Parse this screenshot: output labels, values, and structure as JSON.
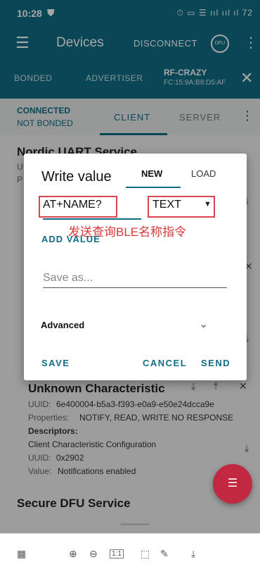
{
  "status": {
    "time": "10:28",
    "left_icon": "shield-icon",
    "right": "⏱ ▭ ☰ ııl ııl ıl 72"
  },
  "appbar": {
    "title": "Devices",
    "disconnect": "DISCONNECT",
    "dfu": "DFU"
  },
  "tabs": {
    "bonded": "BONDED",
    "advertiser": "ADVERTISER",
    "device_name": "RF-CRAZY",
    "device_mac": "FC:15:9A:B8:D5:AF"
  },
  "subtabs": {
    "connected": "CONNECTED",
    "not_bonded": "NOT BONDED",
    "client": "CLIENT",
    "server": "SERVER"
  },
  "background": {
    "service1": "Nordic UART Service",
    "frag_u": "U",
    "frag_p": "P",
    "characteristic": "Unknown Characteristic",
    "uuid_label": "UUID:",
    "uuid": "6e400004-b5a3-f393-e0a9-e50e24dcca9e",
    "props_label": "Properties:",
    "props": "NOTIFY, READ, WRITE NO RESPONSE",
    "descriptors": "Descriptors:",
    "desc_name": "Client Characteristic Configuration",
    "desc_uuid_label": "UUID:",
    "desc_uuid": "0x2902",
    "value_label": "Value:",
    "value": "Notifications enabled",
    "service2": "Secure DFU Service"
  },
  "dialog": {
    "title": "Write value",
    "tab_new": "NEW",
    "tab_load": "LOAD",
    "input_value": "AT+NAME?",
    "type_value": "TEXT",
    "annotation": "发送查询BLE名称指令",
    "add_value": "ADD VALUE",
    "save_as_placeholder": "Save as...",
    "advanced": "Advanced",
    "save": "SAVE",
    "cancel": "CANCEL",
    "send": "SEND"
  },
  "colors": {
    "primary": "#0f6e86",
    "accent": "#c2283f",
    "annotation": "#d63a3a"
  }
}
